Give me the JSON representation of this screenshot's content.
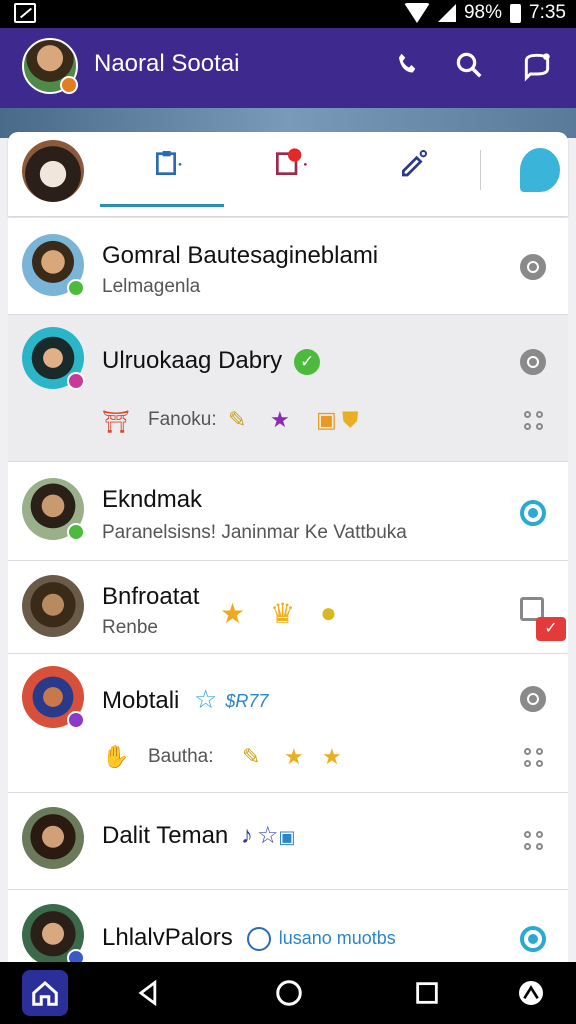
{
  "status_bar": {
    "battery": "98%",
    "time": "7:35"
  },
  "app_bar": {
    "title": "Naoral Sootai"
  },
  "tabs": [
    {
      "icon": "clipboard-icon",
      "active": true
    },
    {
      "icon": "notification-icon",
      "active": false
    },
    {
      "icon": "edit-icon",
      "active": false
    },
    {
      "icon": "chat-bubble-icon",
      "active": false
    }
  ],
  "contacts": [
    {
      "name": "Gomral Bautesagineblami",
      "subtitle": "Lelmagenla",
      "trailing": "radio-grey"
    },
    {
      "name": "Ulruokaag Dabry",
      "subtitle": "Fanoku:",
      "trailing": "more-dots",
      "selected": true,
      "verified": true
    },
    {
      "name": "Ekndmak",
      "subtitle": "Paranelsisns! Janinmar Ke Vattbuka",
      "trailing": "radio-blue"
    },
    {
      "name": "Bnfroatat",
      "subtitle": "Renbe",
      "trailing": "checkbox"
    },
    {
      "name": "Mobtali",
      "subtitle": "Bautha:",
      "trailing": "radio-grey",
      "tag": "$R77"
    },
    {
      "name": "Dalit Teman",
      "subtitle": "",
      "trailing": "more-dots"
    },
    {
      "name": "LhlalvPalors",
      "subtitle": "",
      "trailing": "radio-blue",
      "tag": "lusano muotbs"
    }
  ],
  "colors": {
    "app_bar": "#3e2a8f",
    "accent": "#2aaad2",
    "online": "#4cba3c"
  }
}
